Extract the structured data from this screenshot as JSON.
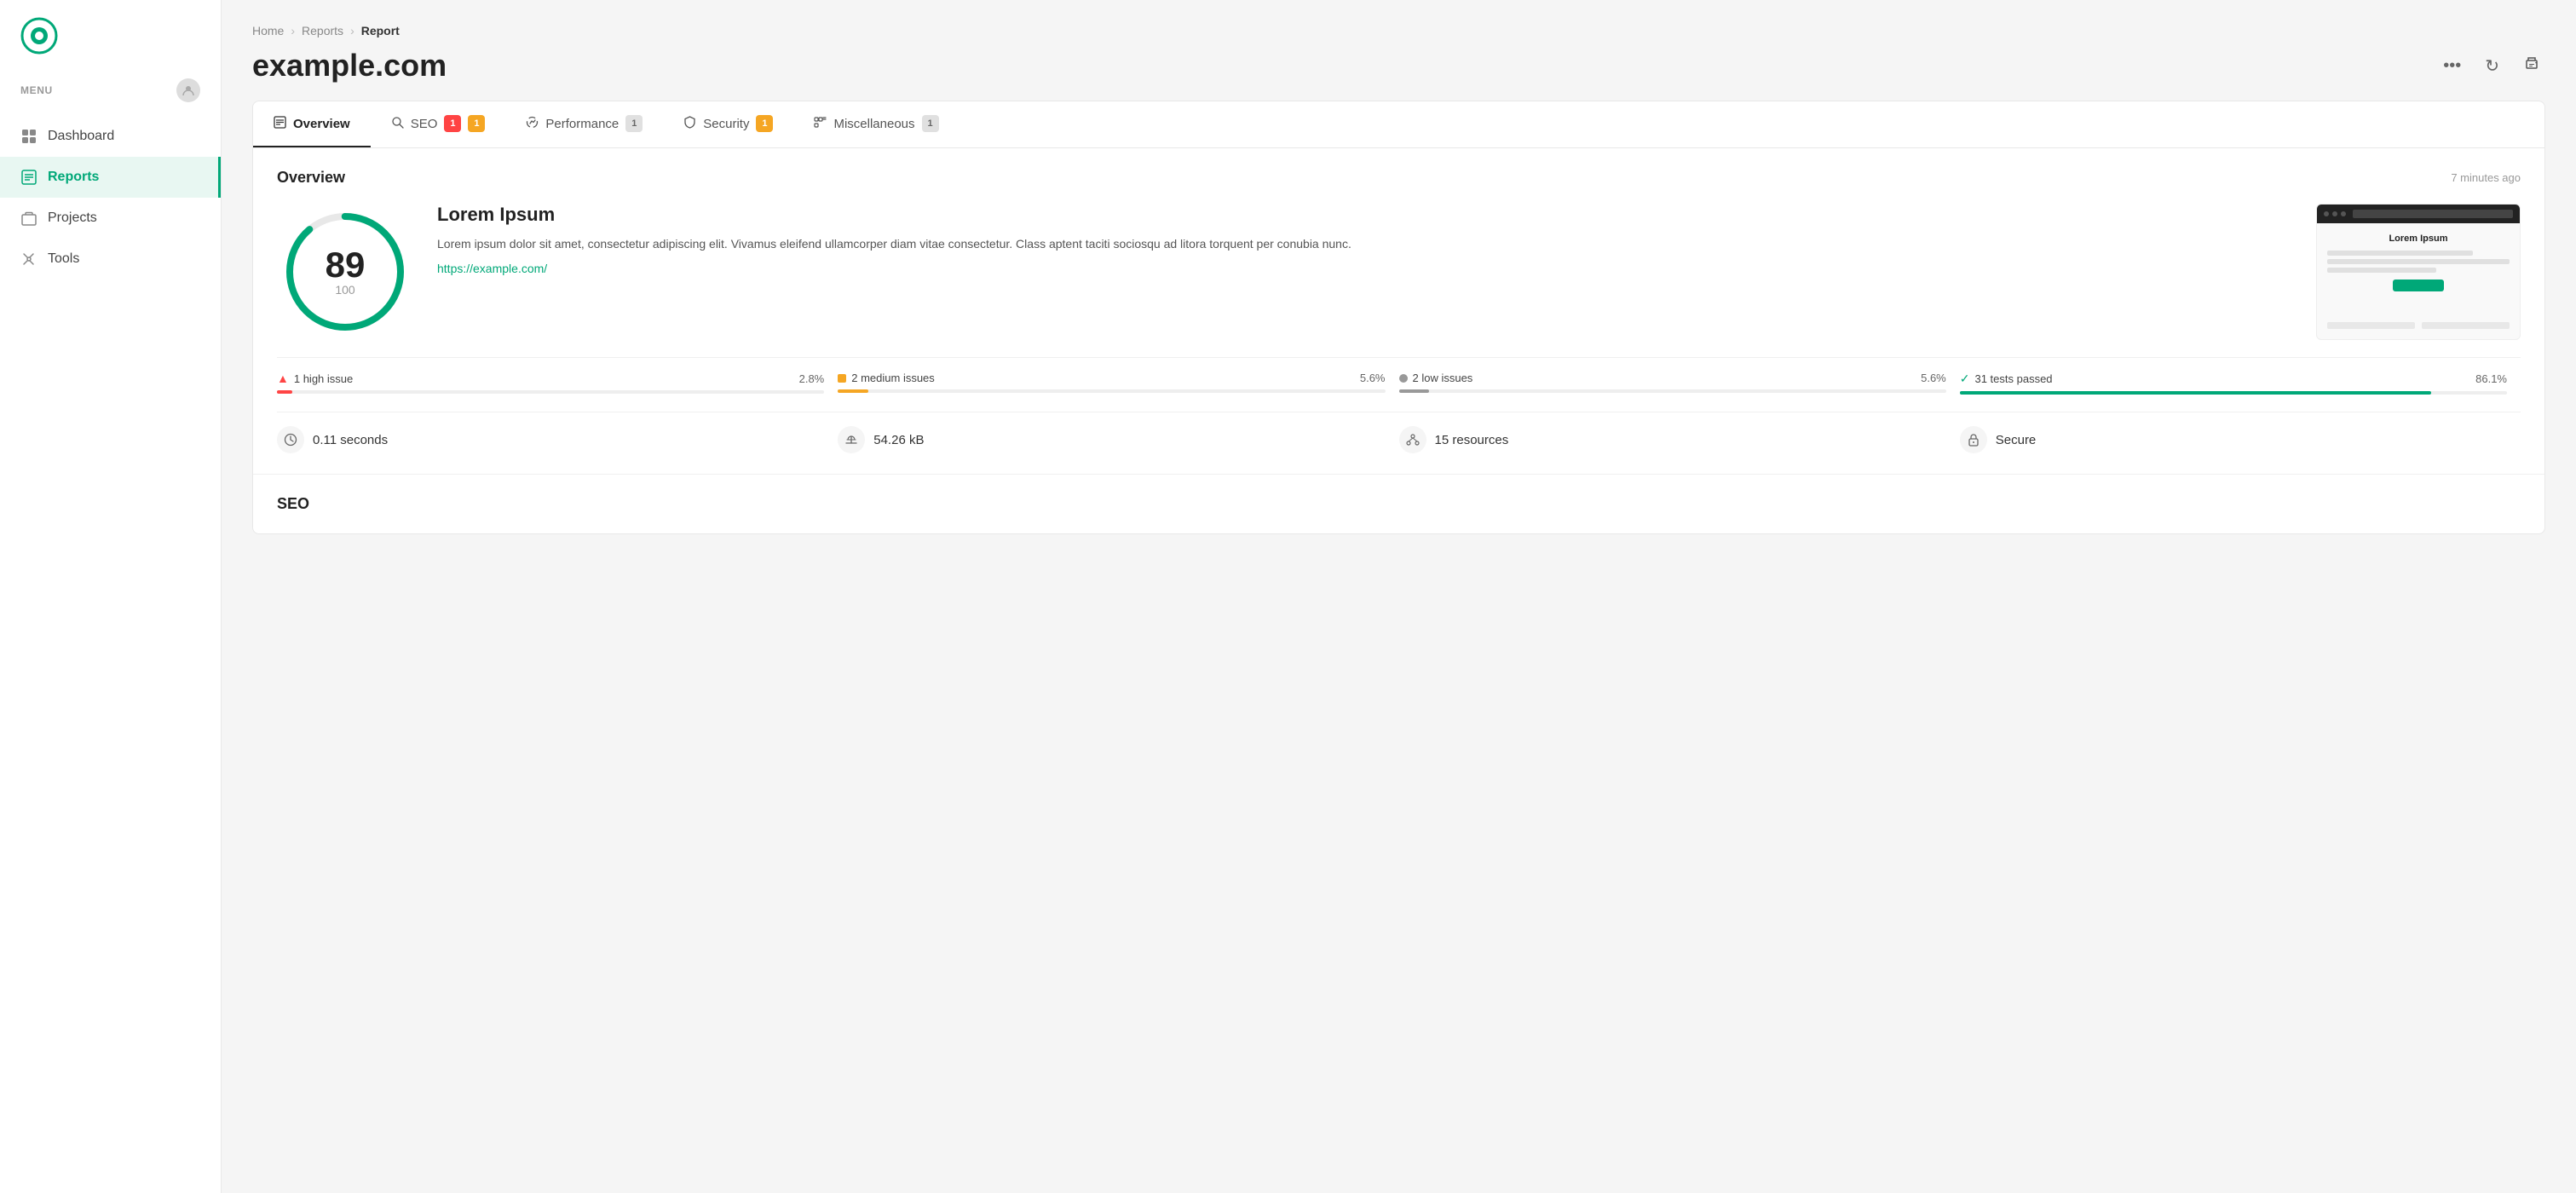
{
  "sidebar": {
    "menu_label": "MENU",
    "nav_items": [
      {
        "id": "dashboard",
        "label": "Dashboard",
        "active": false
      },
      {
        "id": "reports",
        "label": "Reports",
        "active": true
      },
      {
        "id": "projects",
        "label": "Projects",
        "active": false
      },
      {
        "id": "tools",
        "label": "Tools",
        "active": false
      }
    ]
  },
  "breadcrumb": {
    "items": [
      "Home",
      "Reports",
      "Report"
    ]
  },
  "page": {
    "title": "example.com"
  },
  "tabs": [
    {
      "id": "overview",
      "label": "Overview",
      "badge": null,
      "active": true
    },
    {
      "id": "seo",
      "label": "SEO",
      "badge_red": "1",
      "badge_yellow": "1",
      "active": false
    },
    {
      "id": "performance",
      "label": "Performance",
      "badge_gray": "1",
      "active": false
    },
    {
      "id": "security",
      "label": "Security",
      "badge_yellow": "1",
      "active": false
    },
    {
      "id": "miscellaneous",
      "label": "Miscellaneous",
      "badge_gray": "1",
      "active": false
    }
  ],
  "overview": {
    "title": "Overview",
    "time": "7 minutes ago",
    "score": {
      "value": "89",
      "max": "100",
      "percent": 89
    },
    "site_title": "Lorem Ipsum",
    "description": "Lorem ipsum dolor sit amet, consectetur adipiscing elit. Vivamus eleifend ullamcorper diam vitae consectetur. Class aptent taciti sociosqu ad litora torquent per conubia nunc.",
    "url": "https://example.com/",
    "preview_title": "Lorem Ipsum",
    "issues": [
      {
        "icon": "high",
        "label": "1 high issue",
        "pct": "2.8%",
        "fill_pct": 2.8,
        "color": "#ff4444"
      },
      {
        "icon": "medium",
        "label": "2 medium issues",
        "pct": "5.6%",
        "fill_pct": 5.6,
        "color": "#f5a623"
      },
      {
        "icon": "low",
        "label": "2 low issues",
        "pct": "5.6%",
        "fill_pct": 5.6,
        "color": "#999"
      },
      {
        "icon": "pass",
        "label": "31 tests passed",
        "pct": "86.1%",
        "fill_pct": 86.1,
        "color": "#00a878"
      }
    ],
    "stats": [
      {
        "icon": "⏱",
        "label": "0.11 seconds"
      },
      {
        "icon": "⚖",
        "label": "54.26 kB"
      },
      {
        "icon": "🔗",
        "label": "15 resources"
      },
      {
        "icon": "🔒",
        "label": "Secure"
      }
    ]
  },
  "seo_section": {
    "title": "SEO"
  }
}
